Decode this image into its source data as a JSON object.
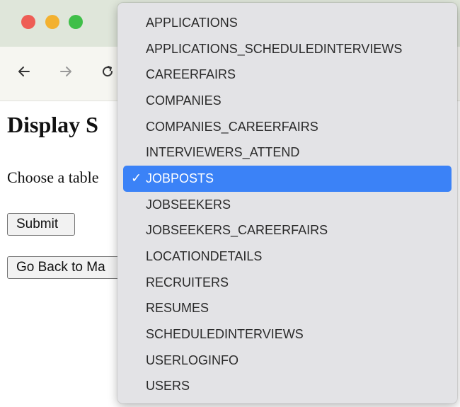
{
  "nav": {
    "back_icon": "arrow-left-icon",
    "forward_icon": "arrow-right-icon",
    "reload_icon": "reload-icon"
  },
  "page": {
    "title": "Display S",
    "choose_label": "Choose a table",
    "submit_label": "Submit",
    "back_label": "Go Back to Ma"
  },
  "dropdown": {
    "selected": "JOBPOSTS",
    "check_glyph": "✓",
    "options": [
      "APPLICATIONS",
      "APPLICATIONS_SCHEDULEDINTERVIEWS",
      "CAREERFAIRS",
      "COMPANIES",
      "COMPANIES_CAREERFAIRS",
      "INTERVIEWERS_ATTEND",
      "JOBPOSTS",
      "JOBSEEKERS",
      "JOBSEEKERS_CAREERFAIRS",
      "LOCATIONDETAILS",
      "RECRUITERS",
      "RESUMES",
      "SCHEDULEDINTERVIEWS",
      "USERLOGINFO",
      "USERS"
    ]
  },
  "colors": {
    "titlebar": "#dfe6da",
    "close": "#ee5d55",
    "minimize": "#f3b12f",
    "maximize": "#3fbf48",
    "selected_bg": "#3b82f7",
    "menu_bg": "#e3e3e6"
  }
}
